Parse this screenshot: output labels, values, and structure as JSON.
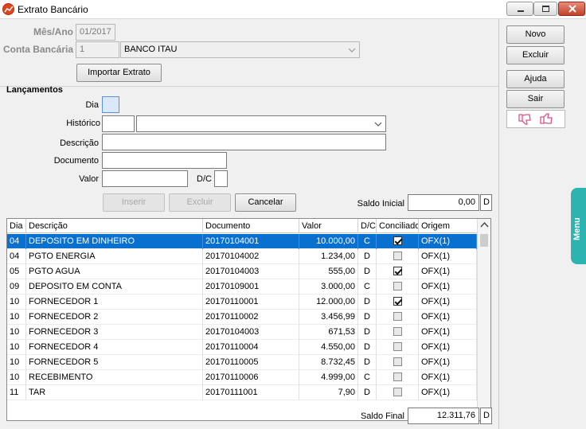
{
  "window": {
    "title": "Extrato Bancário",
    "minimize_icon": "minimize-icon",
    "maximize_icon": "maximize-icon",
    "close_icon": "close-icon"
  },
  "header": {
    "mes_ano_label": "Mês/Ano",
    "mes_ano_value": "01/2017",
    "conta_label": "Conta Bancária",
    "conta_code": "1",
    "conta_name": "BANCO ITAU",
    "importar_button": "Importar Extrato"
  },
  "lancamentos": {
    "section_title": "Lançamentos",
    "dia_label": "Dia",
    "dia_value": "",
    "historico_label": "Histórico",
    "historico_code": "",
    "historico_value": "",
    "descricao_label": "Descrição",
    "descricao_value": "",
    "documento_label": "Documento",
    "documento_value": "",
    "valor_label": "Valor",
    "valor_value": "",
    "dc_label": "D/C",
    "dc_value": "",
    "inserir_button": "Inserir",
    "excluir_button": "Excluir",
    "cancelar_button": "Cancelar",
    "saldo_inicial_label": "Saldo Inicial",
    "saldo_inicial_value": "0,00",
    "saldo_inicial_dc": "D"
  },
  "grid": {
    "columns": [
      "Dia",
      "Descrição",
      "Documento",
      "Valor",
      "D/C",
      "Conciliado",
      "Origem"
    ],
    "rows": [
      {
        "dia": "04",
        "descricao": "DEPOSITO EM DINHEIRO",
        "documento": "20170104001",
        "valor": "10.000,00",
        "dc": "C",
        "conciliado": true,
        "origem": "OFX(1)"
      },
      {
        "dia": "04",
        "descricao": "PGTO ENERGIA",
        "documento": "20170104002",
        "valor": "1.234,00",
        "dc": "D",
        "conciliado": false,
        "origem": "OFX(1)"
      },
      {
        "dia": "05",
        "descricao": "PGTO AGUA",
        "documento": "20170104003",
        "valor": "555,00",
        "dc": "D",
        "conciliado": true,
        "origem": "OFX(1)"
      },
      {
        "dia": "09",
        "descricao": "DEPOSITO EM CONTA",
        "documento": "20170109001",
        "valor": "3.000,00",
        "dc": "C",
        "conciliado": false,
        "origem": "OFX(1)"
      },
      {
        "dia": "10",
        "descricao": "FORNECEDOR 1",
        "documento": "20170110001",
        "valor": "12.000,00",
        "dc": "D",
        "conciliado": true,
        "origem": "OFX(1)"
      },
      {
        "dia": "10",
        "descricao": "FORNECEDOR 2",
        "documento": "20170110002",
        "valor": "3.456,99",
        "dc": "D",
        "conciliado": false,
        "origem": "OFX(1)"
      },
      {
        "dia": "10",
        "descricao": "FORNECEDOR 3",
        "documento": "20170104003",
        "valor": "671,53",
        "dc": "D",
        "conciliado": false,
        "origem": "OFX(1)"
      },
      {
        "dia": "10",
        "descricao": "FORNECEDOR 4",
        "documento": "20170110004",
        "valor": "4.550,00",
        "dc": "D",
        "conciliado": false,
        "origem": "OFX(1)"
      },
      {
        "dia": "10",
        "descricao": "FORNECEDOR 5",
        "documento": "20170110005",
        "valor": "8.732,45",
        "dc": "D",
        "conciliado": false,
        "origem": "OFX(1)"
      },
      {
        "dia": "10",
        "descricao": "RECEBIMENTO",
        "documento": "20170110006",
        "valor": "4.999,00",
        "dc": "C",
        "conciliado": false,
        "origem": "OFX(1)"
      },
      {
        "dia": "11",
        "descricao": "TAR",
        "documento": "20170111001",
        "valor": "7,90",
        "dc": "D",
        "conciliado": false,
        "origem": "OFX(1)"
      }
    ]
  },
  "footer": {
    "saldo_final_label": "Saldo Final",
    "saldo_final_value": "12.311,76",
    "saldo_final_dc": "D"
  },
  "sidebar": {
    "novo_button": "Novo",
    "excluir_button": "Excluir",
    "ajuda_button": "Ajuda",
    "sair_button": "Sair",
    "feedback_icons": [
      "thumbs-down-icon",
      "thumbs-up-icon"
    ],
    "menu_tab": "Menu"
  },
  "colors": {
    "selection": "#0a70d0",
    "menu_tab": "#2db3b0",
    "feedback_pink": "#e0508a"
  }
}
